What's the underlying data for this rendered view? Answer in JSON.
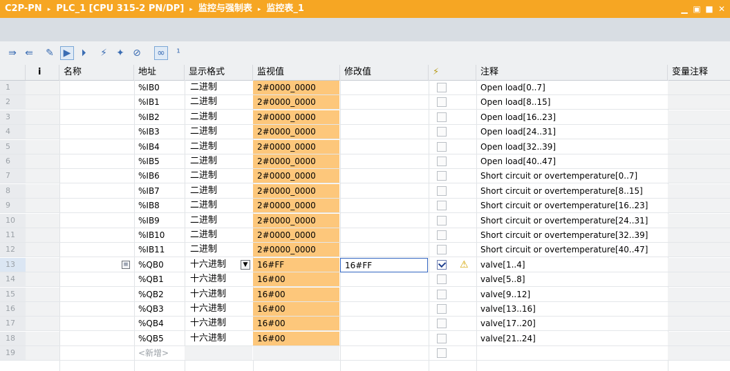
{
  "title": {
    "crumbs": [
      "C2P-PN",
      "PLC_1 [CPU 315-2 PN/DP]",
      "监控与强制表",
      "监控表_1"
    ],
    "separator": "▸",
    "controls": [
      "minimize-icon",
      "restore-icon",
      "maximize-icon",
      "close-icon"
    ]
  },
  "toolbar": {
    "icons": [
      "monitor-all-icon",
      "monitor-once-icon",
      "display-format-icon",
      "modify-now-icon",
      "modify-trigger-icon",
      "enable-peripheral-icon",
      "disable-peripheral-icon",
      "unforce-icon",
      "monitor-all-values-icon",
      "monitor-once-values-icon"
    ]
  },
  "columns": {
    "info": "i",
    "name": "名称",
    "address": "地址",
    "format": "显示格式",
    "monitor": "监视值",
    "modify": "修改值",
    "lightning": "⚡",
    "comment": "注释",
    "var_comment": "变量注释"
  },
  "rows": [
    {
      "i": "1",
      "address": "%IB0",
      "format": "二进制",
      "monitor": "2#0000_0000",
      "modify": "",
      "checked": false,
      "comment": "Open load[0..7]"
    },
    {
      "i": "2",
      "address": "%IB1",
      "format": "二进制",
      "monitor": "2#0000_0000",
      "modify": "",
      "checked": false,
      "comment": "Open load[8..15]"
    },
    {
      "i": "3",
      "address": "%IB2",
      "format": "二进制",
      "monitor": "2#0000_0000",
      "modify": "",
      "checked": false,
      "comment": "Open load[16..23]"
    },
    {
      "i": "4",
      "address": "%IB3",
      "format": "二进制",
      "monitor": "2#0000_0000",
      "modify": "",
      "checked": false,
      "comment": "Open load[24..31]"
    },
    {
      "i": "5",
      "address": "%IB4",
      "format": "二进制",
      "monitor": "2#0000_0000",
      "modify": "",
      "checked": false,
      "comment": "Open load[32..39]"
    },
    {
      "i": "6",
      "address": "%IB5",
      "format": "二进制",
      "monitor": "2#0000_0000",
      "modify": "",
      "checked": false,
      "comment": "Open load[40..47]"
    },
    {
      "i": "7",
      "address": "%IB6",
      "format": "二进制",
      "monitor": "2#0000_0000",
      "modify": "",
      "checked": false,
      "comment": "Short circuit or overtemperature[0..7]"
    },
    {
      "i": "8",
      "address": "%IB7",
      "format": "二进制",
      "monitor": "2#0000_0000",
      "modify": "",
      "checked": false,
      "comment": "Short circuit or overtemperature[8..15]"
    },
    {
      "i": "9",
      "address": "%IB8",
      "format": "二进制",
      "monitor": "2#0000_0000",
      "modify": "",
      "checked": false,
      "comment": "Short circuit or overtemperature[16..23]"
    },
    {
      "i": "10",
      "address": "%IB9",
      "format": "二进制",
      "monitor": "2#0000_0000",
      "modify": "",
      "checked": false,
      "comment": "Short circuit or overtemperature[24..31]"
    },
    {
      "i": "11",
      "address": "%IB10",
      "format": "二进制",
      "monitor": "2#0000_0000",
      "modify": "",
      "checked": false,
      "comment": "Short circuit or overtemperature[32..39]"
    },
    {
      "i": "12",
      "address": "%IB11",
      "format": "二进制",
      "monitor": "2#0000_0000",
      "modify": "",
      "checked": false,
      "comment": "Short circuit or overtemperature[40..47]"
    },
    {
      "i": "13",
      "address": "%QB0",
      "format": "十六进制",
      "monitor": "16#FF",
      "modify": "16#FF",
      "checked": true,
      "warning": "⚠",
      "comment": "valve[1..4]"
    },
    {
      "i": "14",
      "address": "%QB1",
      "format": "十六进制",
      "monitor": "16#00",
      "modify": "",
      "checked": false,
      "comment": "valve[5..8]"
    },
    {
      "i": "15",
      "address": "%QB2",
      "format": "十六进制",
      "monitor": "16#00",
      "modify": "",
      "checked": false,
      "comment": "valve[9..12]"
    },
    {
      "i": "16",
      "address": "%QB3",
      "format": "十六进制",
      "monitor": "16#00",
      "modify": "",
      "checked": false,
      "comment": "valve[13..16]"
    },
    {
      "i": "17",
      "address": "%QB4",
      "format": "十六进制",
      "monitor": "16#00",
      "modify": "",
      "checked": false,
      "comment": "valve[17..20]"
    },
    {
      "i": "18",
      "address": "%QB5",
      "format": "十六进制",
      "monitor": "16#00",
      "modify": "",
      "checked": false,
      "comment": "valve[21..24]"
    },
    {
      "i": "19",
      "address": "<新增>",
      "format": "",
      "monitor": "",
      "modify": "",
      "checked": false,
      "comment": ""
    }
  ],
  "colors": {
    "title_bg": "#f6a623",
    "monitor_bg": "#fdc77b"
  }
}
